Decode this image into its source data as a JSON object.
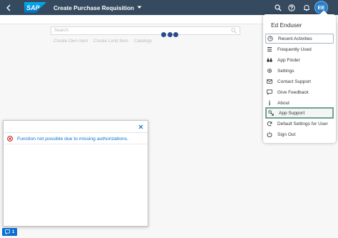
{
  "shell": {
    "title": "Create Purchase Requisition",
    "logo_text": "SAP",
    "avatar_initials": "EE",
    "header_color": "#354a5f",
    "accent_color": "#0a6ed1"
  },
  "page": {
    "search_placeholder": "Search",
    "links": [
      {
        "label": "Create Own Item"
      },
      {
        "label": "Create Limit Item"
      },
      {
        "label": "Catalogs"
      }
    ]
  },
  "dialog": {
    "message": "Function not possible due to missing authorizations."
  },
  "message_indicator": {
    "count": "1"
  },
  "user_menu": {
    "user_name": "Ed Enduser",
    "items": [
      {
        "label": "Recent Activities",
        "icon": "clock-icon"
      },
      {
        "label": "Frequently Used",
        "icon": "list-icon"
      },
      {
        "label": "App Finder",
        "icon": "binoculars-icon"
      },
      {
        "label": "Settings",
        "icon": "gear-icon"
      },
      {
        "label": "Contact Support",
        "icon": "envelope-icon"
      },
      {
        "label": "Give Feedback",
        "icon": "feedback-icon"
      },
      {
        "label": "About",
        "icon": "info-icon"
      },
      {
        "label": "App Support",
        "icon": "app-support-icon"
      },
      {
        "label": "Default Settings for User",
        "icon": "refresh-icon"
      },
      {
        "label": "Sign Out",
        "icon": "power-icon"
      }
    ]
  }
}
